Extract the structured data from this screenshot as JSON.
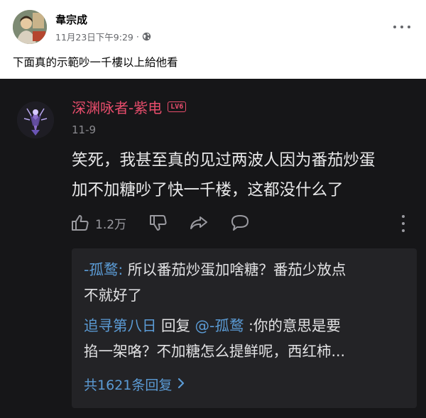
{
  "post": {
    "author_name": "韋宗成",
    "timestamp": "11月23日下午9:29",
    "separator": "·",
    "audience_icon": "globe-icon",
    "text": "下面真的示範吵一千樓以上給他看",
    "more_icon": "more-horizontal-icon"
  },
  "comment": {
    "username": "深渊咏者-紫电",
    "level_badge": "LV6",
    "date": "11-9",
    "body_line1": "笑死，我甚至真的见过两波人因为番茄炒蛋",
    "body_line2": "加不加糖吵了快一千楼，这都没什么了",
    "like_count": "1.2万",
    "icons": [
      "thumbs-up-icon",
      "thumbs-down-icon",
      "share-icon",
      "reply-icon",
      "more-vertical-icon"
    ]
  },
  "replies": {
    "r1_user": "-孤鹜",
    "r1_colon": ":",
    "r1_line1": " 所以番茄炒蛋加啥糖？番茄少放点",
    "r1_line2": "不就好了",
    "r2_user": "追寻第八日",
    "r2_reply_word": " 回复 ",
    "r2_mention": "@-孤鹜",
    "r2_line1": " :你的意思是要",
    "r2_line2": "掐一架咯？不加糖怎么提鲜呢，西红柿...",
    "more_label": "共1621条回复",
    "more_icon": "chevron-right-icon"
  },
  "colors": {
    "dark_bg": "#161618",
    "reply_bg": "#232326",
    "username_pink": "#e84d6c",
    "link_blue": "#5b9bd5"
  }
}
